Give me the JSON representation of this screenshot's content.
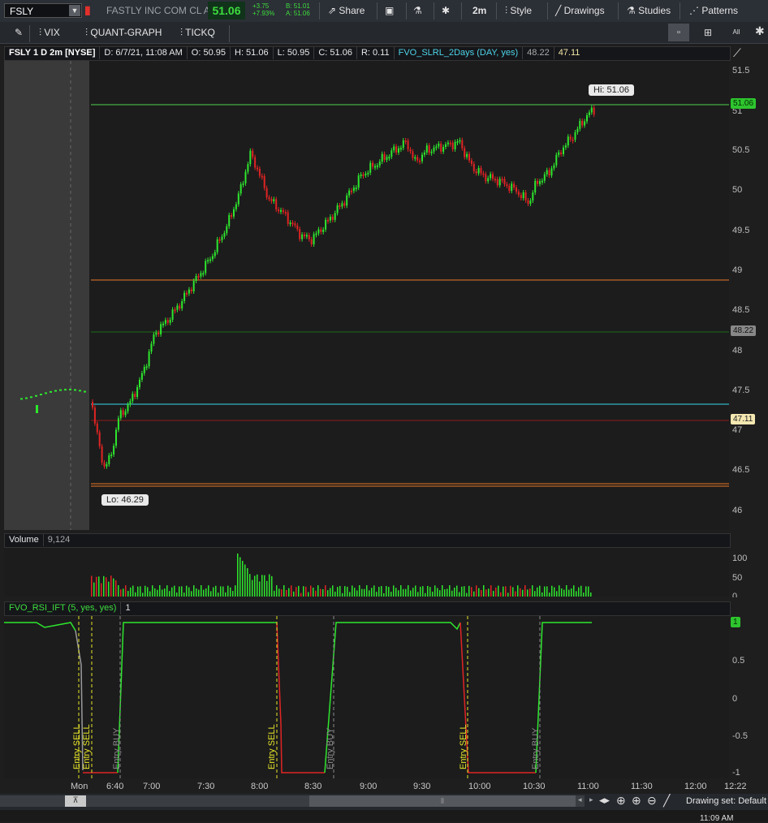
{
  "toolbar": {
    "symbol": "FSLY",
    "company": "FASTLY INC COM CL A",
    "last": "51.06",
    "change_abs": "+3.75",
    "change_pct": "+7.93%",
    "bid": "B: 51.01",
    "ask": "A: 51.06",
    "share_label": "Share",
    "timeframe": "2m",
    "style_label": "Style",
    "drawings_label": "Drawings",
    "studies_label": "Studies",
    "patterns_label": "Patterns"
  },
  "quickbar": {
    "items": [
      "VIX",
      "QUANT-GRAPH",
      "TICKQ"
    ],
    "all_label": "All"
  },
  "price_panel": {
    "title": "FSLY 1 D 2m [NYSE]",
    "date": "D: 6/7/21, 11:08 AM",
    "open": "O: 50.95",
    "high": "H: 51.06",
    "low": "L: 50.95",
    "close": "C: 51.06",
    "range": "R: 0.11",
    "study": "FVO_SLRL_2Days (DAY, yes)",
    "study_v1": "48.22",
    "study_v2": "47.11",
    "hi_label": "Hi: 51.06",
    "lo_label": "Lo: 46.29",
    "price_tag": "51.06",
    "level_tag_1": "48.22",
    "level_tag_2": "47.11",
    "ticks": [
      "51.5",
      "51",
      "50.5",
      "50",
      "49.5",
      "49",
      "48.5",
      "48",
      "47.5",
      "47",
      "46.5",
      "46"
    ]
  },
  "volume_panel": {
    "title": "Volume",
    "value": "9,124",
    "ticks": [
      "100",
      "50",
      "0"
    ]
  },
  "rsi_panel": {
    "title": "FVO_RSI_IFT (5, yes, yes)",
    "value": "1",
    "tag": "1",
    "ticks": [
      "0.5",
      "0",
      "-0.5",
      "-1"
    ],
    "signals": [
      "Entry SELL",
      "Entry SELL",
      "Entry BUY",
      "Entry SELL",
      "Entry BUY",
      "Entry SELL",
      "Entry BUY"
    ]
  },
  "time_axis": [
    "Mon",
    "6:40",
    "7:00",
    "7:30",
    "8:00",
    "8:30",
    "9:00",
    "9:30",
    "10:00",
    "10:30",
    "11:00",
    "11:30",
    "12:00",
    "12:22"
  ],
  "bottom": {
    "drawing_set": "Drawing set: Default",
    "clock": "11:09 AM"
  },
  "colors": {
    "up": "#2ee62e",
    "down": "#e02424",
    "hi_line": "#4fd04f",
    "orange_line": "#e8782a",
    "cyan_line": "#38d6e6",
    "darkred_line": "#8a1a1a",
    "green_line": "#1d6b1d",
    "signal_yellow": "#e6e62a",
    "signal_gray": "#8a8a8a"
  }
}
